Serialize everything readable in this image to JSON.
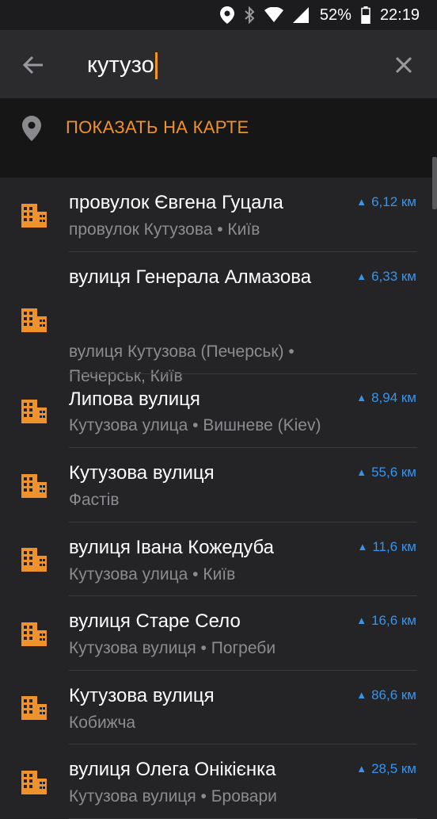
{
  "status_bar": {
    "battery_percent": "52%",
    "time": "22:19",
    "icons": [
      "location-icon",
      "bluetooth-icon",
      "wifi-icon",
      "signal-icon",
      "battery-icon"
    ]
  },
  "search": {
    "query": "кутузо",
    "back_icon": "arrow-left-icon",
    "clear_icon": "close-icon"
  },
  "show_on_map": {
    "label": "ПОКАЗАТЬ НА КАРТЕ",
    "icon": "map-pin-icon",
    "color": "#ef922b"
  },
  "results": [
    {
      "name": "провулок Євгена Гуцала",
      "address": "провулок Кутузова • Київ",
      "distance": "6,12 км"
    },
    {
      "name": "вулиця Генерала Алмазова",
      "address": "вулиця Кутузова (Печерськ) • Печерськ, Київ",
      "distance": "6,33 км"
    },
    {
      "name": "Липова вулиця",
      "address": "Кутузова улица • Вишневе (Kiev)",
      "distance": "8,94 км"
    },
    {
      "name": "Кутузова вулиця",
      "address": "Фастів",
      "distance": "55,6 км"
    },
    {
      "name": "вулиця Івана Кожедуба",
      "address": "Кутузова улица • Київ",
      "distance": "11,6 км"
    },
    {
      "name": "вулиця Старе Село",
      "address": "Кутузова вулиця • Погреби",
      "distance": "16,6 км"
    },
    {
      "name": "Кутузова вулиця",
      "address": "Кобижча",
      "distance": "86,6 км"
    },
    {
      "name": "вулиця Олега Онікієнка",
      "address": "Кутузова вулиця • Бровари",
      "distance": "28,5 км"
    }
  ],
  "colors": {
    "accent_orange": "#ef922b",
    "distance_blue": "#3b93e8",
    "background": "#242426"
  }
}
